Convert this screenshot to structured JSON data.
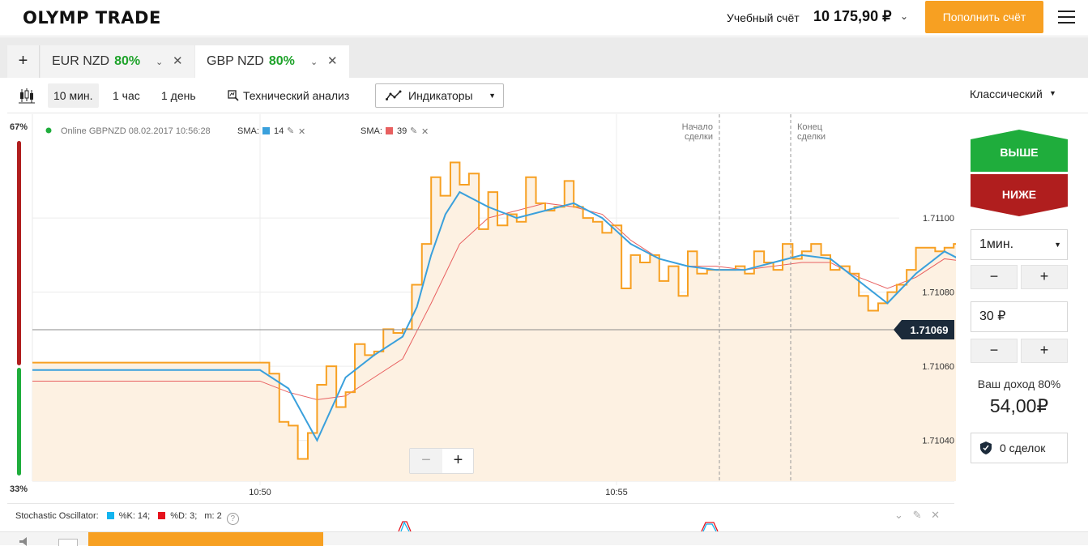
{
  "header": {
    "logo": "OLYMP TRADE",
    "account_label": "Учебный счёт",
    "account_balance": "10 175,90 ₽",
    "deposit_button": "Пополнить счёт"
  },
  "tabs": [
    {
      "pair": "EUR NZD",
      "payout": "80%",
      "active": false
    },
    {
      "pair": "GBP NZD",
      "payout": "80%",
      "active": true
    }
  ],
  "toolbar": {
    "timeframes": [
      "10 мин.",
      "1 час",
      "1 день"
    ],
    "selected_timeframe": "10 мин.",
    "tech_analysis": "Технический анализ",
    "indicators": "Индикаторы",
    "chart_style": "Классический"
  },
  "chart": {
    "status_text": "Online GBPNZD 08.02.2017 10:56:28",
    "sentiment_top": "67%",
    "sentiment_bottom": "33%",
    "deal_start": [
      "Начало",
      "сделки"
    ],
    "deal_end": [
      "Конец",
      "сделки"
    ],
    "current_price": "1.71069",
    "indicators": [
      {
        "label": "SMA:",
        "period": "14",
        "color": "#3aa0dc"
      },
      {
        "label": "SMA:",
        "period": "39",
        "color": "#e86060"
      }
    ]
  },
  "chart_data": {
    "type": "line",
    "x_ticks": [
      "10:50",
      "10:55"
    ],
    "y_ticks": [
      "1.71100",
      "1.71080",
      "1.71060",
      "1.71040"
    ],
    "ylim": [
      1.71029,
      1.71128
    ],
    "colors": {
      "price": "#f7a022",
      "sma14": "#3aa0dc",
      "sma39": "#e86060",
      "area": "#fdf1e2"
    },
    "series": [
      {
        "name": "GBPNZD",
        "x_min": [
          9.0,
          9.13,
          9.27,
          9.4,
          9.53,
          9.67,
          9.8,
          9.93,
          10.07,
          10.2,
          10.33,
          10.47,
          10.6,
          10.73,
          10.87,
          11.0,
          11.13,
          11.27,
          11.4,
          11.53,
          11.67,
          11.8,
          11.93,
          12.07,
          12.2,
          12.33,
          12.47,
          12.6,
          12.73,
          12.87,
          13.0,
          13.13,
          13.27,
          13.4,
          13.53,
          13.67,
          13.8,
          13.93,
          14.07,
          14.2,
          14.33,
          14.47,
          14.6,
          14.73,
          14.87,
          15.0,
          15.13,
          15.27,
          15.4,
          15.53,
          15.67,
          15.8,
          15.93,
          16.07,
          16.2,
          16.33,
          16.47,
          16.6,
          16.73,
          16.87,
          17.0,
          17.13,
          17.27,
          17.4,
          17.53,
          17.67,
          17.8,
          17.93,
          18.07,
          18.2,
          18.33,
          18.47,
          18.6,
          18.73,
          18.87,
          19.0,
          19.13,
          19.27,
          19.4,
          19.53,
          19.67,
          19.8
        ],
        "values": [
          1.71061,
          1.71058,
          1.71045,
          1.71044,
          1.71035,
          1.71042,
          1.71055,
          1.7106,
          1.71049,
          1.71053,
          1.71066,
          1.71063,
          1.71064,
          1.7107,
          1.71069,
          1.7107,
          1.71082,
          1.71093,
          1.71111,
          1.71106,
          1.71115,
          1.71109,
          1.71112,
          1.71097,
          1.71107,
          1.71098,
          1.71101,
          1.71099,
          1.71111,
          1.71104,
          1.71102,
          1.71103,
          1.7111,
          1.71103,
          1.711,
          1.71099,
          1.71096,
          1.71098,
          1.71081,
          1.7109,
          1.71088,
          1.7109,
          1.71083,
          1.71087,
          1.71079,
          1.71091,
          1.71085,
          1.71086,
          1.71086,
          1.71086,
          1.71087,
          1.71085,
          1.71091,
          1.71088,
          1.71086,
          1.71093,
          1.71089,
          1.71091,
          1.71093,
          1.7109,
          1.71086,
          1.71087,
          1.71085,
          1.71079,
          1.71075,
          1.71077,
          1.7108,
          1.71082,
          1.71086,
          1.71092,
          1.71092,
          1.71091,
          1.71092,
          1.71093,
          1.71091,
          1.71088,
          1.71064,
          1.71066,
          1.7107,
          1.71069,
          1.7107,
          1.71069
        ]
      },
      {
        "name": "SMA 14",
        "x_min": [
          9.0,
          9.4,
          9.8,
          10.2,
          10.6,
          11.0,
          11.2,
          11.4,
          11.6,
          11.8,
          12.2,
          12.6,
          13.0,
          13.4,
          13.8,
          14.2,
          14.6,
          15.0,
          15.4,
          15.8,
          16.2,
          16.6,
          17.0,
          17.4,
          17.8,
          18.2,
          18.6,
          19.0,
          19.4,
          19.8
        ],
        "values": [
          1.71059,
          1.71054,
          1.7104,
          1.71057,
          1.71063,
          1.71068,
          1.71076,
          1.7109,
          1.71101,
          1.71107,
          1.71103,
          1.711,
          1.71102,
          1.71104,
          1.711,
          1.71093,
          1.71089,
          1.71087,
          1.71086,
          1.71086,
          1.71088,
          1.7109,
          1.71089,
          1.71083,
          1.71077,
          1.71085,
          1.71091,
          1.71087,
          1.71072,
          1.7107
        ]
      },
      {
        "name": "SMA 39",
        "x_min": [
          9.0,
          9.4,
          9.8,
          10.2,
          10.6,
          11.0,
          11.4,
          11.8,
          12.2,
          12.6,
          13.0,
          13.4,
          13.8,
          14.2,
          14.6,
          15.0,
          15.4,
          15.8,
          16.2,
          16.6,
          17.0,
          17.4,
          17.8,
          18.2,
          18.6,
          19.0,
          19.4,
          19.8
        ],
        "values": [
          1.71056,
          1.71053,
          1.71051,
          1.71052,
          1.71057,
          1.71062,
          1.71077,
          1.71093,
          1.711,
          1.71102,
          1.71104,
          1.71103,
          1.71101,
          1.71094,
          1.71089,
          1.71087,
          1.71087,
          1.71086,
          1.71087,
          1.71088,
          1.71088,
          1.71084,
          1.71081,
          1.71084,
          1.71089,
          1.71088,
          1.71079,
          1.71072
        ]
      }
    ]
  },
  "trade_panel": {
    "up_button": "ВЫШЕ",
    "down_button": "НИЖЕ",
    "up_color": "#1fad3c",
    "down_color": "#b01e1e",
    "duration": "1мин.",
    "minus": "−",
    "plus": "+",
    "amount": "30 ₽",
    "income_label": "Ваш доход 80%",
    "income_value": "54,00₽",
    "deals": "0 сделок"
  },
  "zoom": {
    "minus": "−",
    "plus": "+"
  },
  "stochastic": {
    "title": "Stochastic Oscillator:",
    "k_label": "%K: 14;",
    "d_label": "%D: 3;",
    "m_label": "m: 2",
    "help": "?",
    "k_color": "#13b4ef",
    "d_color": "#e5121d"
  }
}
